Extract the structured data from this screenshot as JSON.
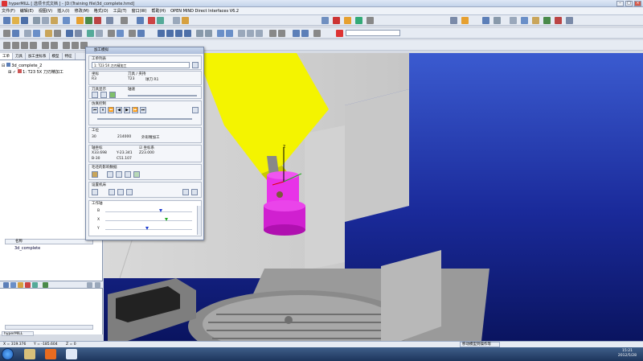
{
  "window": {
    "title": "hyperMILL [ 选项卡式文档 ] - [D:\\Training file\\3d_complete.hmd]"
  },
  "menu": [
    "文件(F)",
    "编辑(E)",
    "视图(V)",
    "插入(I)",
    "修改(M)",
    "格式(O)",
    "工具(T)",
    "窗口(W)",
    "帮助(H)",
    "OPEN MIND Direct Interfaces V6.2"
  ],
  "toolbar": {
    "combo_value": ""
  },
  "left_panel": {
    "tabs": [
      "工单",
      "刀具",
      "加工坐标系",
      "模型",
      "特征"
    ],
    "tree_root": "3d_complete_2",
    "tree_child": "1: T23 5X 刀刃精加工",
    "list_header": "名称",
    "list_item": "3d_complete",
    "list_tab": "hyperMILL"
  },
  "dialog": {
    "title": "加工模拟",
    "job_list_label": "工单列表",
    "job_list_value": "1: T23 5X 刀刃精加工",
    "frame_label": "坐标",
    "frame_value": "R3",
    "tool_label": "刀具 / 夹持",
    "tool_value": "T23",
    "tool_desc": "球刀 R1",
    "display_label": "刀具显示",
    "speed_label": "轴速",
    "sim_control_label": "仿真控制",
    "step_label": "工位",
    "step_number": "30",
    "step_value": "214000",
    "step_name": "外形精加工",
    "pos_label": "轴坐标",
    "pos_x": "X33.698",
    "pos_y": "Y-23.341",
    "pos_z": "Z23.000",
    "pos_b": "B-30",
    "pos_c": "C51.107",
    "coord_label": "坐标系",
    "material_label": "毛坯的影响数据",
    "machine_label": "设置机床",
    "axis_panel_label": "工作轴",
    "axes": [
      "B",
      "X",
      "Y"
    ],
    "axis_values": [
      0.64,
      0.7,
      0.48
    ]
  },
  "status": {
    "x": "X = 319.376",
    "y": "Y = -185.604",
    "z": "Z = 0",
    "message": "移动模型到操作等"
  },
  "taskbar": {
    "time": "15:21",
    "date": "2012/5/28"
  }
}
